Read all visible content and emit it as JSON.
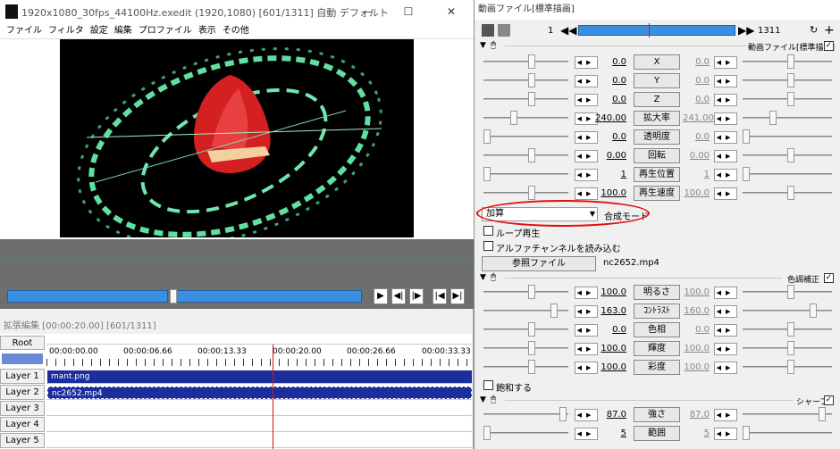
{
  "main": {
    "title": "1920x1080_30fps_44100Hz.exedit (1920,1080)  [601/1311]  自動  デフォルト",
    "window_buttons": [
      "—",
      "☐",
      "✕"
    ],
    "menu": [
      "ファイル",
      "フィルタ",
      "設定",
      "編集",
      "プロファイル",
      "表示",
      "その他"
    ],
    "playback": [
      "▶",
      "◀|",
      "|▶",
      "|◀",
      "▶|"
    ]
  },
  "timeline": {
    "title": "拡張編集 [00:00:20.00] [601/1311]",
    "root": "Root",
    "ticks": [
      "00:00:00.00",
      "00:00:06.66",
      "00:00:13.33",
      "00:00:20.00",
      "00:00:26.66",
      "00:00:33.33"
    ],
    "layers": [
      "Layer 1",
      "Layer 2",
      "Layer 3",
      "Layer 4",
      "Layer 5"
    ],
    "clips": [
      "mant.png",
      "nc2652.mp4"
    ]
  },
  "settings": {
    "title": "動画ファイル[標準描画]",
    "frame_start": "1",
    "frame_end": "1311",
    "group1": "動画ファイル[標準描画]",
    "params": [
      {
        "label": "X",
        "v1": "0.0",
        "v2": "0.0"
      },
      {
        "label": "Y",
        "v1": "0.0",
        "v2": "0.0"
      },
      {
        "label": "Z",
        "v1": "0.0",
        "v2": "0.0"
      },
      {
        "label": "拡大率",
        "v1": "240.00",
        "v2": "241.00"
      },
      {
        "label": "透明度",
        "v1": "0.0",
        "v2": "0.0"
      },
      {
        "label": "回転",
        "v1": "0.00",
        "v2": "0.00"
      },
      {
        "label": "再生位置",
        "v1": "1",
        "v2": "1"
      },
      {
        "label": "再生速度",
        "v1": "100.0",
        "v2": "100.0"
      }
    ],
    "blend_value": "加算",
    "blend_label": "合成モード",
    "loop": "ループ再生",
    "alpha": "アルファチャンネルを読み込む",
    "ref_button": "参照ファイル",
    "ref_file": "nc2652.mp4",
    "group2": "色調補正",
    "color_params": [
      {
        "label": "明るさ",
        "v1": "100.0",
        "v2": "100.0"
      },
      {
        "label": "ｺﾝﾄﾗｽﾄ",
        "v1": "163.0",
        "v2": "160.0"
      },
      {
        "label": "色相",
        "v1": "0.0",
        "v2": "0.0"
      },
      {
        "label": "輝度",
        "v1": "100.0",
        "v2": "100.0"
      },
      {
        "label": "彩度",
        "v1": "100.0",
        "v2": "100.0"
      }
    ],
    "saturate": "飽和する",
    "group3": "シャープ",
    "sharp_params": [
      {
        "label": "強さ",
        "v1": "87.0",
        "v2": "87.0"
      },
      {
        "label": "範囲",
        "v1": "5",
        "v2": "5"
      }
    ]
  },
  "colors": {
    "clip": "#1c2d9c",
    "accent": "#3a8fe0",
    "highlight": "#e01010",
    "flame": "#d42020",
    "ring": "#5fe0a0"
  }
}
